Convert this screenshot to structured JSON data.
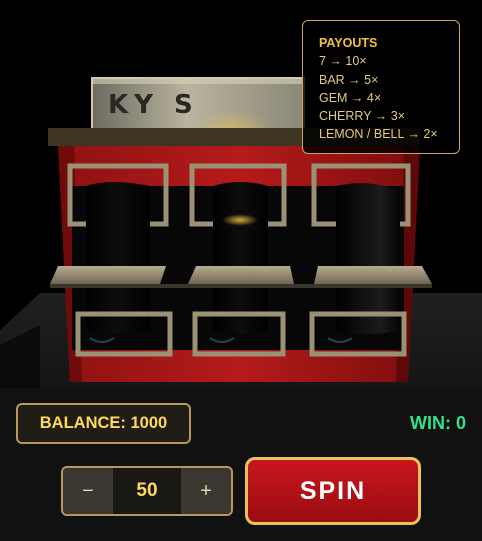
{
  "scene": {
    "sign_text": "KY S",
    "colors": {
      "cabinet": "#b51b1b",
      "cabinet_dark": "#6f0b0b",
      "gold": "#c9a45a",
      "reel": "#050505"
    }
  },
  "payouts": {
    "title": "PAYOUTS",
    "rows": [
      "7 → 10×",
      "BAR → 5×",
      "GEM → 4×",
      "CHERRY → 3×",
      "LEMON / BELL → 2×"
    ]
  },
  "hud": {
    "balance_label": "BALANCE: 1000",
    "win_label": "WIN: 0",
    "bet_value": "50",
    "minus_label": "−",
    "plus_label": "+",
    "spin_label": "SPIN",
    "colors": {
      "balance_text": "#ffd95a",
      "win_text": "#36e08b",
      "spin_bg": "#b5121a",
      "border_gold": "#b9975b"
    }
  }
}
